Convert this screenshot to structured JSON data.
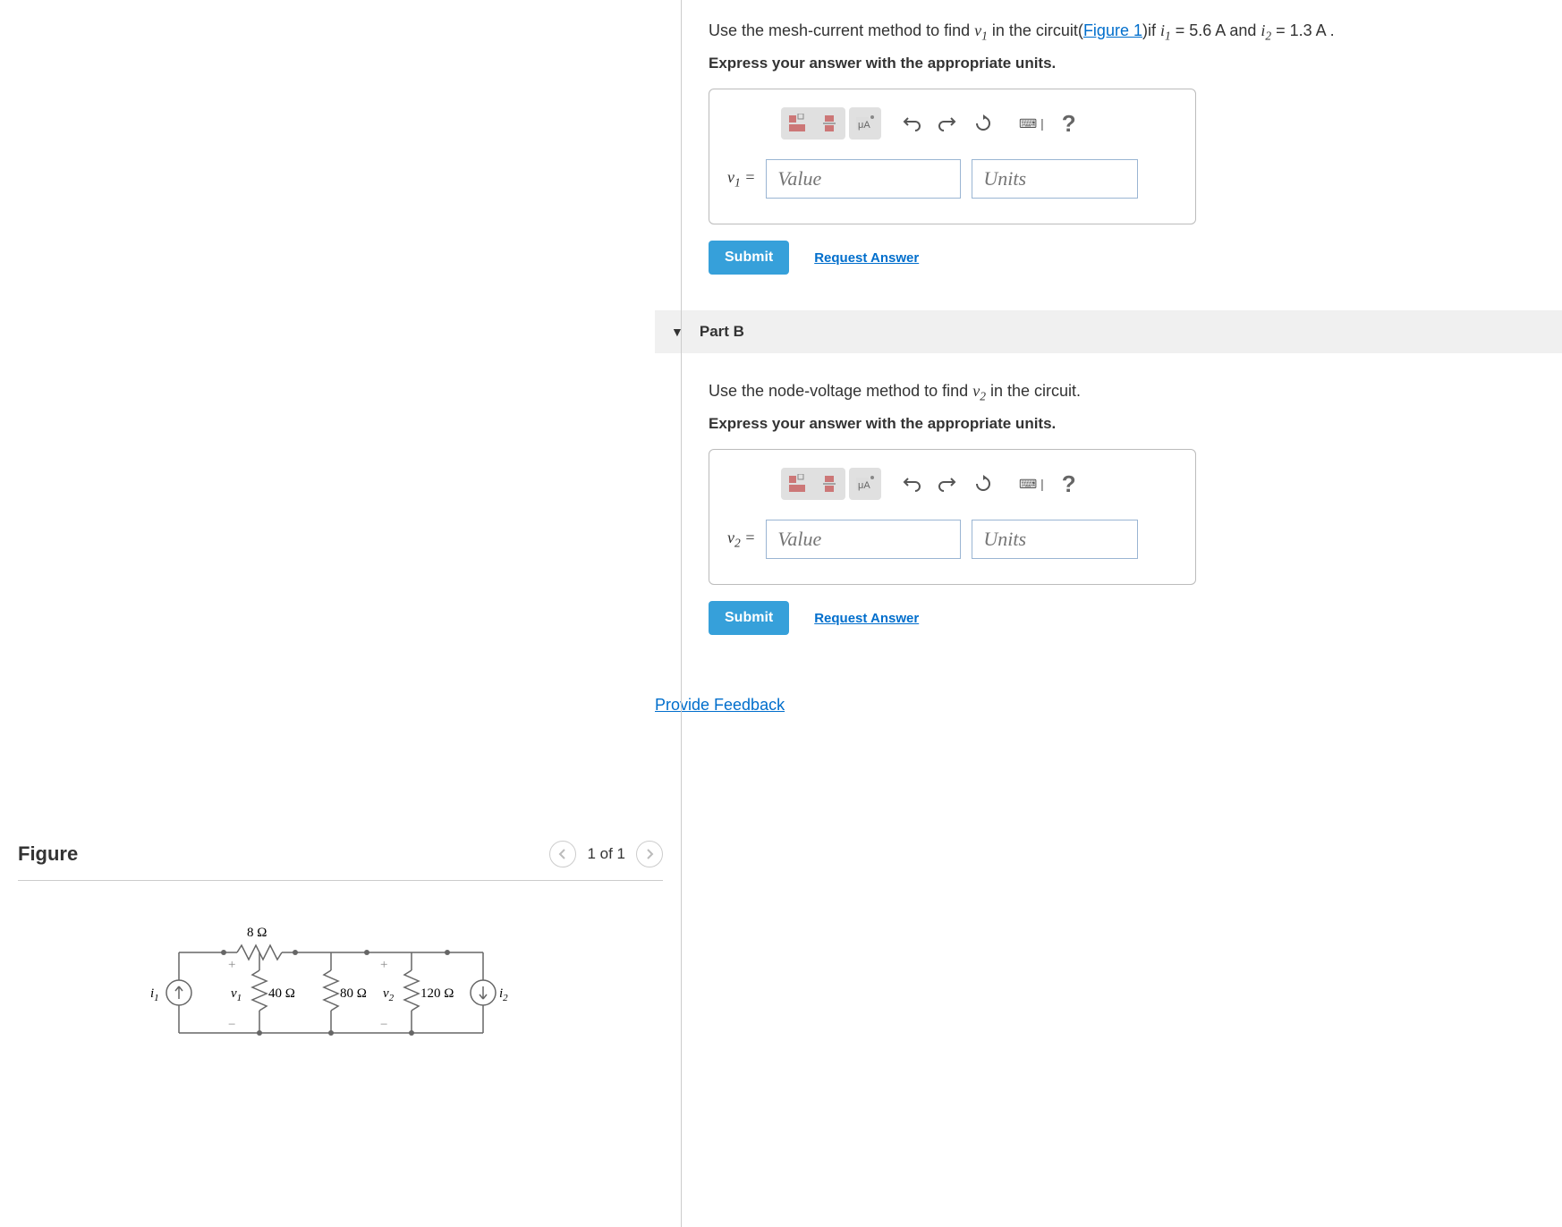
{
  "partA": {
    "prompt_pre": "Use the mesh-current method to find ",
    "var1": "v",
    "sub1": "1",
    "prompt_mid": " in the circuit(",
    "figlink": "Figure 1",
    "prompt_post": ")if ",
    "ivar1": "i",
    "isub1": "1",
    "eq1": " = 5.6 A",
    "and": " and ",
    "ivar2": "i",
    "isub2": "2",
    "eq2": " = 1.3 A .",
    "hint": "Express your answer with the appropriate units.",
    "label_var": "v",
    "label_sub": "1",
    "equals": " =",
    "value_ph": "Value",
    "units_ph": "Units",
    "submit": "Submit",
    "request": "Request Answer"
  },
  "partB": {
    "title": "Part B",
    "prompt_pre": "Use the node-voltage method to find ",
    "var1": "v",
    "sub1": "2",
    "prompt_post": " in the circuit.",
    "hint": "Express your answer with the appropriate units.",
    "label_var": "v",
    "label_sub": "2",
    "equals": " =",
    "value_ph": "Value",
    "units_ph": "Units",
    "submit": "Submit",
    "request": "Request Answer"
  },
  "feedback": "Provide Feedback",
  "figure": {
    "title": "Figure",
    "page": "1 of 1",
    "labels": {
      "i1": "i",
      "i1s": "1",
      "i2": "i",
      "i2s": "2",
      "v1": "v",
      "v1s": "1",
      "v2": "v",
      "v2s": "2",
      "r8": "8 Ω",
      "r40": "40 Ω",
      "r80": "80 Ω",
      "r120": "120 Ω"
    }
  },
  "toolbar": {
    "help": "?",
    "keyboard": "⌨ |"
  }
}
